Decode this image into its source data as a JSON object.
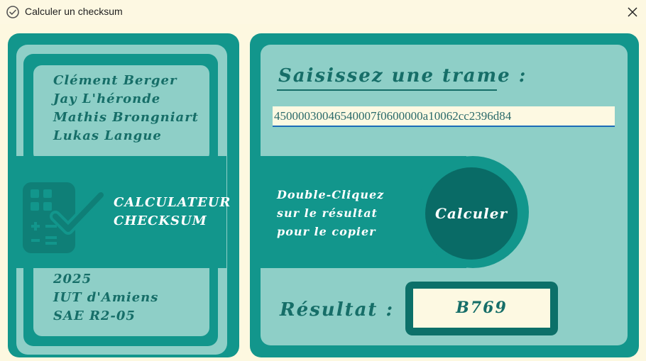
{
  "window": {
    "title": "Calculer un checksum",
    "icon": "check-circle-icon",
    "close_icon": "close-icon"
  },
  "authors": [
    "Clément Berger",
    "Jay L'héronde",
    "Mathis Brongniart",
    "Lukas Langue"
  ],
  "app": {
    "icon": "calculator-check-icon",
    "name_line1": "CALCULATEUR",
    "name_line2": "CHECKSUM"
  },
  "info": [
    "2025",
    "IUT d'Amiens",
    "SAE R2-05"
  ],
  "input": {
    "label": "Saisissez une trame :",
    "value": "45000030046540007f0600000a10062cc2396d84"
  },
  "hint": [
    "Double-Cliquez",
    "sur le résultat",
    "pour le copier"
  ],
  "calculate_button": {
    "label": "Calculer"
  },
  "result": {
    "label": "Résultat :",
    "value": "B769"
  },
  "colors": {
    "teal": "#12968c",
    "light_teal": "#8ecfc7",
    "dark_teal": "#096b66",
    "cream": "#fdf9e2"
  }
}
